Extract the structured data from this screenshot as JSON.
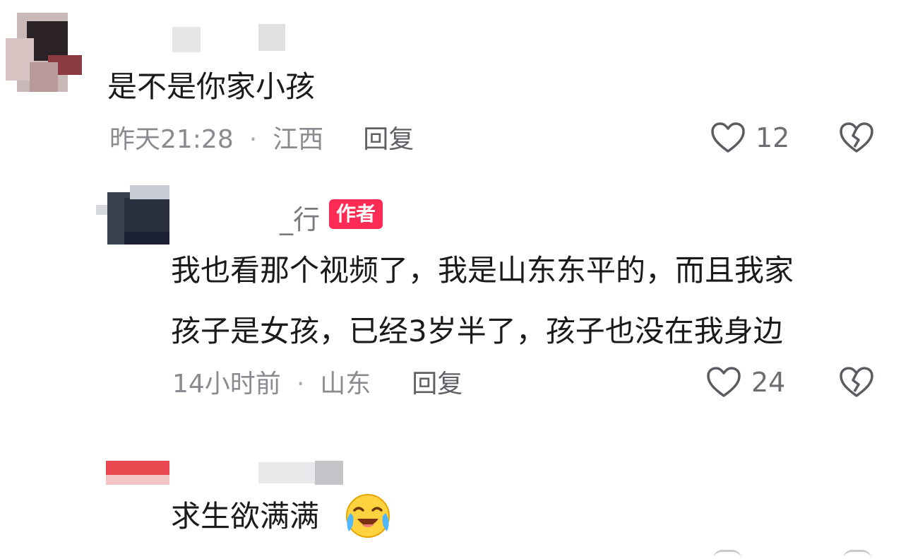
{
  "comments": [
    {
      "text": "是不是你家小孩",
      "time": "昨天21:28",
      "location": "江西",
      "reply_label": "回复",
      "likes": "12",
      "separator": "·"
    },
    {
      "name_fragment": "_行",
      "author_tag": "作者",
      "text_line1": "我也看那个视频了，我是山东东平的，而且我家",
      "text_line2": "孩子是女孩，已经3岁半了，孩子也没在我身边",
      "time": "14小时前",
      "location": "山东",
      "reply_label": "回复",
      "likes": "24",
      "separator": "·"
    },
    {
      "text": "求生欲满满"
    }
  ],
  "icons": {
    "like": "heart-outline-icon",
    "dislike": "broken-heart-icon",
    "emoji": "crying-laughing-emoji"
  },
  "colors": {
    "author_tag": "#fe2c55",
    "meta_text": "#8a8b91"
  }
}
